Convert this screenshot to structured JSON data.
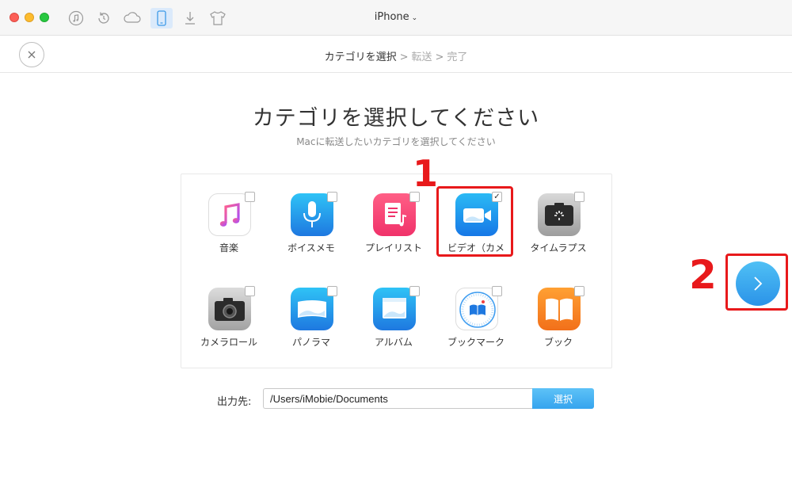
{
  "window": {
    "device_title": "iPhone"
  },
  "toolbar": {
    "icons": [
      "music-icon",
      "restore-icon",
      "cloud-icon",
      "phone-icon",
      "download-icon",
      "tshirt-icon"
    ]
  },
  "breadcrumb": {
    "step1": "カテゴリを選択",
    "sep1": ">",
    "step2": "転送",
    "sep2": ">",
    "step3": "完了"
  },
  "main": {
    "title": "カテゴリを選択してください",
    "subtitle": "Macに転送したいカテゴリを選択してください"
  },
  "categories": [
    {
      "label": "音楽",
      "icon": "music-note-icon",
      "checked": false
    },
    {
      "label": "ボイスメモ",
      "icon": "microphone-icon",
      "checked": false
    },
    {
      "label": "プレイリスト",
      "icon": "playlist-icon",
      "checked": false
    },
    {
      "label": "ビデオ（カメ",
      "icon": "video-camera-icon",
      "checked": true,
      "check_mark": "✓"
    },
    {
      "label": "タイムラプス",
      "icon": "timelapse-icon",
      "checked": false
    },
    {
      "label": "カメラロール",
      "icon": "camera-icon",
      "checked": false
    },
    {
      "label": "パノラマ",
      "icon": "panorama-icon",
      "checked": false
    },
    {
      "label": "アルバム",
      "icon": "album-icon",
      "checked": false
    },
    {
      "label": "ブックマーク",
      "icon": "safari-bookmark-icon",
      "checked": false
    },
    {
      "label": "ブック",
      "icon": "book-icon",
      "checked": false
    }
  ],
  "annotations": {
    "one": "1",
    "two": "2"
  },
  "output": {
    "label": "出力先:",
    "path": "/Users/iMobie/Documents",
    "select_button": "選択"
  },
  "colors": {
    "highlight": "#e8191b",
    "accent": "#36a4ee"
  }
}
